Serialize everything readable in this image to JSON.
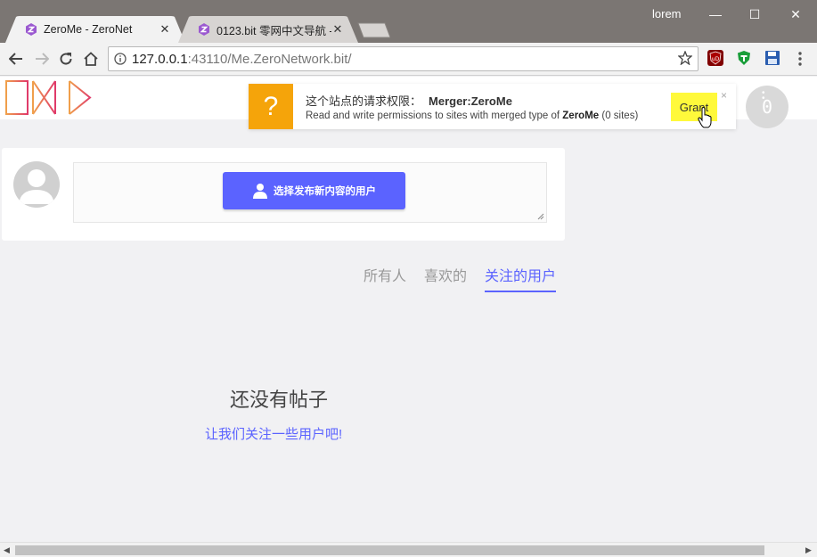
{
  "window": {
    "user": "lorem",
    "minimize_icon": "—",
    "maximize_icon": "☐",
    "close_icon": "✕"
  },
  "tabs": [
    {
      "title": "ZeroMe - ZeroNet",
      "active": true
    },
    {
      "title": "0123.bit 零网中文导航 -",
      "active": false
    }
  ],
  "tab_close": "✕",
  "address_bar": {
    "host": "127.0.0.1",
    "port": ":43110",
    "path": "/Me.ZeroNetwork.bit/"
  },
  "colors": {
    "accent": "#5b63ff",
    "notify_icon_bg": "#f5a40a",
    "grant_bg": "#fff93b"
  },
  "notification": {
    "icon": "?",
    "title": "这个站点的请求权限：",
    "permission": "Merger:ZeroMe",
    "desc_prefix": "Read and write permissions to sites with merged type of ",
    "desc_bold": "ZeroMe",
    "desc_suffix": " (0 sites)",
    "grant_label": "Grant",
    "close": "×"
  },
  "menu_counter": "0",
  "post_box": {
    "select_user_button": "选择发布新内容的用户"
  },
  "feed_tabs": [
    {
      "label": "所有人",
      "active": false
    },
    {
      "label": "喜欢的",
      "active": false
    },
    {
      "label": "关注的用户",
      "active": true
    }
  ],
  "empty_state": {
    "title": "还没有帖子",
    "link": "让我们关注一些用户吧!"
  },
  "scrollbar": {
    "left_arrow": "◀",
    "right_arrow": "▶"
  }
}
